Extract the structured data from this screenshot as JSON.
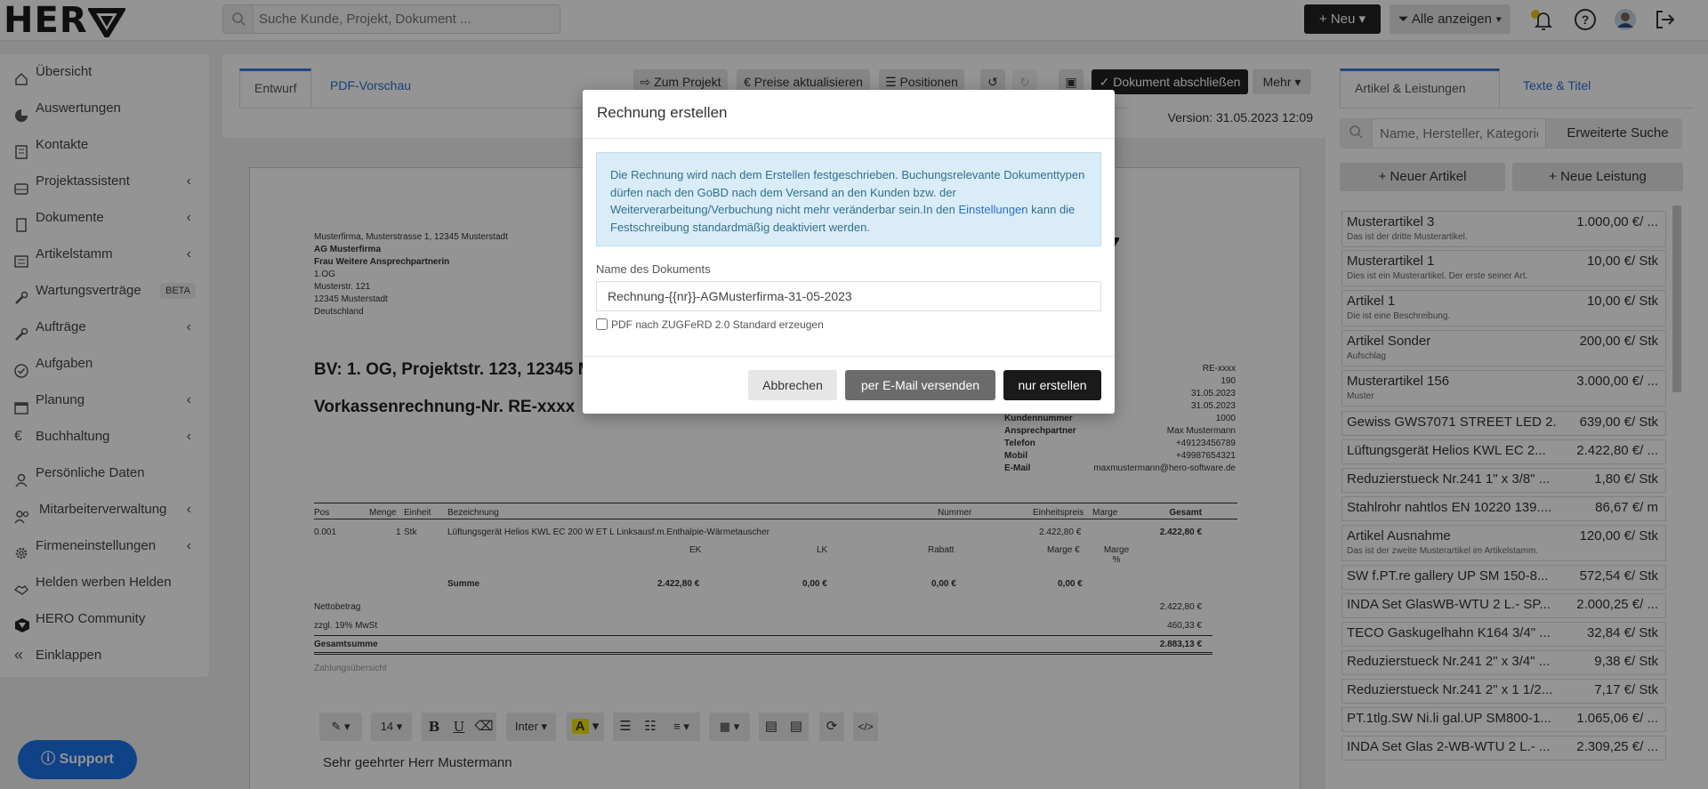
{
  "header": {
    "logo": "HER",
    "search_placeholder": "Suche Kunde, Projekt, Dokument ...",
    "new_button": "Neu",
    "filter_button": "Alle anzeigen"
  },
  "sidebar": {
    "items": [
      {
        "label": "Übersicht",
        "chevron": false
      },
      {
        "label": "Auswertungen",
        "chevron": false
      },
      {
        "label": "Kontakte",
        "chevron": false
      },
      {
        "label": "Projektassistent",
        "chevron": true
      },
      {
        "label": "Dokumente",
        "chevron": true
      },
      {
        "label": "Artikelstamm",
        "chevron": true
      },
      {
        "label": "Wartungsverträge",
        "chevron": false,
        "badge": "BETA"
      },
      {
        "label": "Aufträge",
        "chevron": true
      },
      {
        "label": "Aufgaben",
        "chevron": false
      },
      {
        "label": "Planung",
        "chevron": true
      },
      {
        "label": "Buchhaltung",
        "chevron": true
      },
      {
        "label": "Persönliche Daten",
        "chevron": false
      },
      {
        "label": "Mitarbeiterverwaltung",
        "chevron": true
      },
      {
        "label": "Firmeneinstellungen",
        "chevron": true
      },
      {
        "label": "Helden werben Helden",
        "chevron": false
      },
      {
        "label": "HERO Community",
        "chevron": false
      },
      {
        "label": "Einklappen",
        "chevron": false
      }
    ],
    "support": "Support"
  },
  "editor": {
    "tab_draft": "Entwurf",
    "tab_pdf": "PDF-Vorschau",
    "btn_project": "Zum Projekt",
    "btn_prices": "Preise aktualisieren",
    "btn_positions": "Positionen",
    "btn_finish": "Dokument abschließen",
    "btn_more": "Mehr",
    "version": "Version: 31.05.2023 12:09"
  },
  "document": {
    "sender": "Musterfirma, Musterstrasse 1, 12345 Musterstadt",
    "recipient": [
      "AG Musterfirma",
      "Frau Weitere Ansprechpartnerin",
      "1.OG",
      "Musterstr. 121",
      "12345 Musterstadt",
      "Deutschland"
    ],
    "bv": "BV: 1. OG, Projektstr. 123, 12345 M",
    "title": "Vorkassenrechnung-Nr. RE-xxxx",
    "meta_values": [
      "RE-xxxx",
      "190",
      "31.05.2023",
      "31.05.2023",
      "1000",
      "Max Mustermann",
      "+49123456789",
      "+49987654321",
      "maxmustermann@hero-software.de"
    ],
    "meta_labels": [
      "Kundennummer",
      "Ansprechpartner",
      "Telefon",
      "Mobil",
      "E-Mail"
    ],
    "table_headers": [
      "Pos",
      "Menge",
      "Einheit",
      "Bezeichnung",
      "Nummer",
      "Einheitspreis",
      "Marge",
      "Gesamt"
    ],
    "row": {
      "pos": "0.001",
      "qty": "1",
      "unit": "Stk",
      "desc": "Lüftungsgerät Helios KWL EC 200 W ET L Linksausf.m.Enthalpie-Wärmetauscher",
      "price": "2.422,80 €",
      "total": "2.422,80 €"
    },
    "sub_headers": [
      "EK",
      "LK",
      "Rabatt",
      "Marge €",
      "Marge %"
    ],
    "sum_label": "Summe",
    "sum_values": [
      "2.422,80 €",
      "0,00 €",
      "0,00 €",
      "0,00 €"
    ],
    "netto_label": "Nettobetrag",
    "netto_value": "2.422,80 €",
    "tax_label": "zzgl. 19% MwSt",
    "tax_value": "460,33 €",
    "total_label": "Gesamtsumme",
    "total_value": "2.883,13 €",
    "payment": "Zahlungsübersicht",
    "font_size": "14",
    "font_name": "Inter",
    "greeting": "Sehr geehrter Herr Mustermann"
  },
  "right": {
    "tab_articles": "Artikel & Leistungen",
    "tab_texts": "Texte & Titel",
    "search_placeholder": "Name, Hersteller, Kategorie",
    "advanced": "Erweiterte Suche",
    "new_article": "Neuer Artikel",
    "new_service": "Neue Leistung",
    "articles": [
      {
        "name": "Musterartikel 3",
        "price": "1.000,00 €/ ...",
        "desc": "Das ist der dritte Musterartikel."
      },
      {
        "name": "Musterartikel 1",
        "price": "10,00 €/ Stk",
        "desc": "Dies ist ein Musterartikel. Der erste seiner Art."
      },
      {
        "name": "Artikel 1",
        "price": "10,00 €/ Stk",
        "desc": "Die ist eine Beschreibung."
      },
      {
        "name": "Artikel Sonder",
        "price": "200,00 €/ Stk",
        "desc": "Aufschlag"
      },
      {
        "name": "Musterartikel 156",
        "price": "3.000,00 €/ ...",
        "desc": "Muster"
      },
      {
        "name": "Gewiss GWS7071 STREET LED 2...",
        "price": "639,00 €/ Stk",
        "desc": ""
      },
      {
        "name": "Lüftungsgerät Helios KWL EC 2...",
        "price": "2.422,80 €/ ...",
        "desc": ""
      },
      {
        "name": "Reduzierstueck Nr.241 1\" x 3/8\" ...",
        "price": "1,80 €/ Stk",
        "desc": ""
      },
      {
        "name": "Stahlrohr nahtlos EN 10220 139....",
        "price": "86,67 €/ m",
        "desc": ""
      },
      {
        "name": "Artikel Ausnahme",
        "price": "120,00 €/ Stk",
        "desc": "Das ist der zweite Musterartikel im Artikelstamm."
      },
      {
        "name": "SW f.PT.re gallery UP SM 150-8...",
        "price": "572,54 €/ Stk",
        "desc": ""
      },
      {
        "name": "INDA Set GlasWB-WTU 2 L.- SP...",
        "price": "2.000,25 €/ ...",
        "desc": ""
      },
      {
        "name": "TECO Gaskugelhahn K164 3/4\" ...",
        "price": "32,84 €/ Stk",
        "desc": ""
      },
      {
        "name": "Reduzierstueck Nr.241 2\" x 3/4\" ...",
        "price": "9,38 €/ Stk",
        "desc": ""
      },
      {
        "name": "Reduzierstueck Nr.241 2\" x 1 1/2...",
        "price": "7,17 €/ Stk",
        "desc": ""
      },
      {
        "name": "PT.1tlg.SW Ni.li gal.UP SM800-1...",
        "price": "1.065,06 €/ ...",
        "desc": ""
      },
      {
        "name": "INDA Set Glas 2-WB-WTU 2 L.- ...",
        "price": "2.309,25 €/ ...",
        "desc": ""
      }
    ]
  },
  "modal": {
    "title": "Rechnung erstellen",
    "info_text": "Die Rechnung wird nach dem Erstellen festgeschrieben. Buchungsrelevante Dokumenttypen dürfen nach den GoBD nach dem Versand an den Kunden bzw. der Weiterverarbeitung/Verbuchung nicht mehr veränderbar sein.In den",
    "info_link": "Einstellungen",
    "info_text_end": "kann die Festschreibung standardmäßig deaktiviert werden.",
    "name_label": "Name des Dokuments",
    "name_value": "Rechnung-{{nr}}-AGMusterfirma-31-05-2023",
    "checkbox_label": "PDF nach ZUGFeRD 2.0 Standard erzeugen",
    "cancel": "Abbrechen",
    "email": "per E-Mail versenden",
    "create": "nur erstellen"
  }
}
